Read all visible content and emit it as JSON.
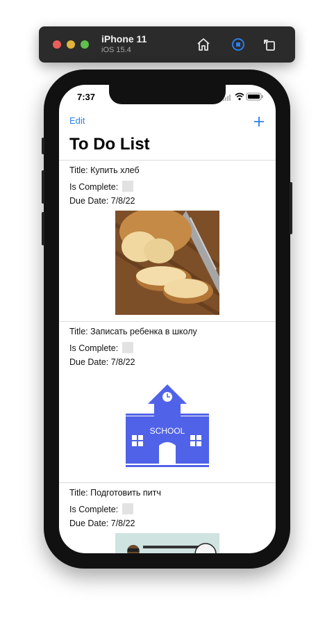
{
  "simulator": {
    "device_name": "iPhone 11",
    "os_version": "iOS 15.4",
    "icons": [
      "home-icon",
      "screenshot-icon",
      "rotate-icon"
    ]
  },
  "status_bar": {
    "time": "7:37"
  },
  "nav": {
    "edit_label": "Edit",
    "add_icon": "plus-icon",
    "title": "To Do List"
  },
  "todos": [
    {
      "title_line": "Title: Купить хлеб",
      "complete_label": "Is Complete:",
      "due_line": "Due Date: 7/8/22",
      "image": "bread-photo"
    },
    {
      "title_line": "Title: Записать ребенка в школу",
      "complete_label": "Is Complete:",
      "due_line": "Due Date: 7/8/22",
      "image": "school-illustration",
      "image_text": "SCHOOL"
    },
    {
      "title_line": "Title: Подготовить питч",
      "complete_label": "Is Complete:",
      "due_line": "Due Date: 7/8/22",
      "image": "pitch-illustration"
    }
  ],
  "colors": {
    "accent": "#2b7de9",
    "school_blue": "#5062e8",
    "checkbox": "#e2e2e2"
  }
}
